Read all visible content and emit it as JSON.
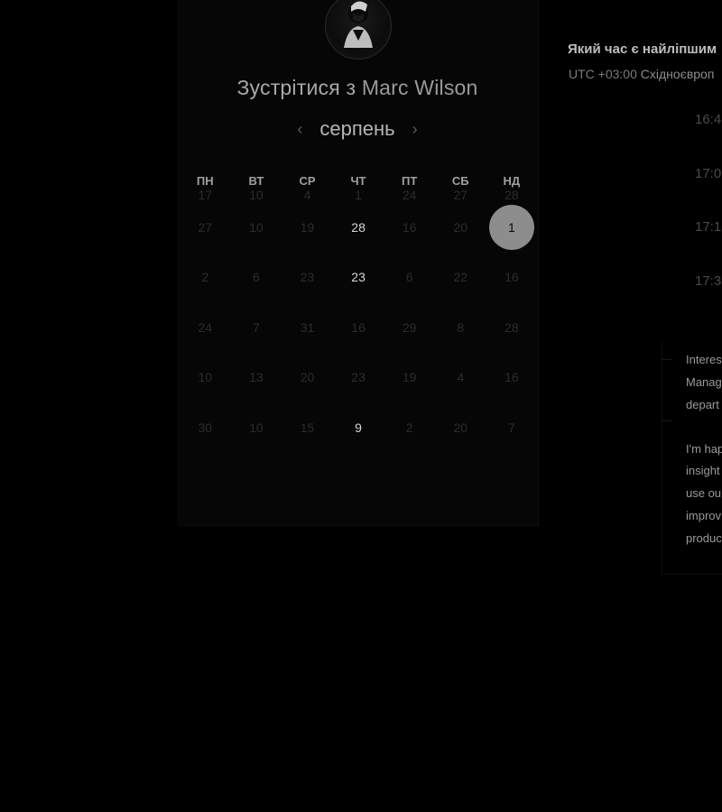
{
  "meeting": {
    "title_prefix": "Зустрітися з",
    "host_name": "Marc Wilson"
  },
  "calendar": {
    "month": "серпень",
    "prev_icon": "‹",
    "next_icon": "›",
    "weekdays": [
      "ПН",
      "ВТ",
      "СР",
      "ЧТ",
      "ПТ",
      "СБ",
      "НД"
    ],
    "rows": [
      [
        "17",
        "10",
        "4",
        "1",
        "24",
        "27",
        "28"
      ],
      [
        "27",
        "10",
        "19",
        "28",
        "16",
        "20",
        "1"
      ],
      [
        "2",
        "6",
        "23",
        "23",
        "6",
        "22",
        "16"
      ],
      [
        "24",
        "7",
        "31",
        "16",
        "29",
        "8",
        "28"
      ],
      [
        "10",
        "13",
        "20",
        "23",
        "19",
        "4",
        "16"
      ],
      [
        "30",
        "10",
        "15",
        "9",
        "2",
        "20",
        "7"
      ]
    ],
    "selected_day": "1"
  },
  "schedule": {
    "heading": "Який час є найліпшим",
    "timezone_offset": "UTC +03:00",
    "timezone_name": "Східноєвроп",
    "slots": [
      "16:4",
      "17:0",
      "17:1",
      "17:3"
    ]
  },
  "notes": {
    "line1": [
      "Interes",
      "Manag",
      "depart"
    ],
    "line2": [
      "I'm hap",
      "insight",
      "use ou",
      "improv",
      "produc"
    ]
  },
  "colors": {
    "background": "#000000",
    "card": "#060606",
    "selected_day": "#8d8d8d",
    "active_day": "#d6d6d6",
    "muted_day": "#2c2c2c"
  }
}
